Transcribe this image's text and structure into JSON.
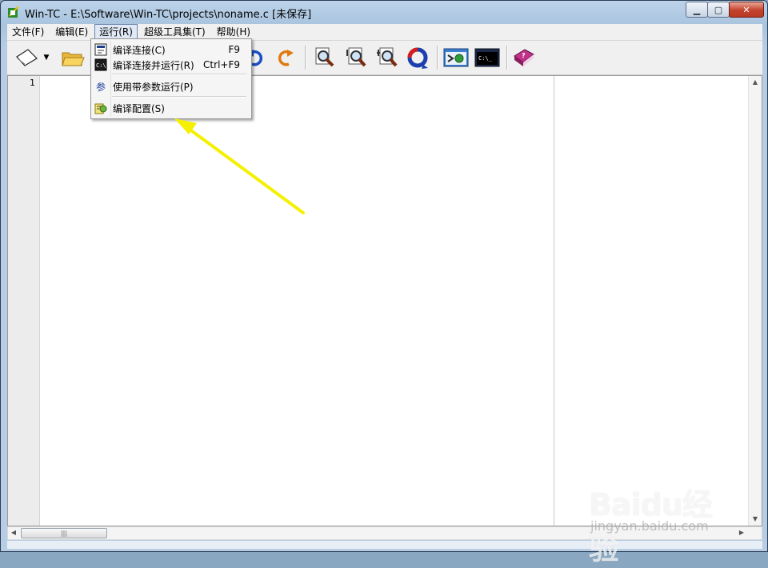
{
  "window": {
    "title": "Win-TC - E:\\Software\\Win-TC\\projects\\noname.c [未保存]",
    "caption_buttons": [
      "minimize",
      "maximize",
      "close"
    ]
  },
  "menubar": {
    "items": [
      {
        "label": "文件(F)",
        "open": false
      },
      {
        "label": "编辑(E)",
        "open": false
      },
      {
        "label": "运行(R)",
        "open": true
      },
      {
        "label": "超级工具集(T)",
        "open": false
      },
      {
        "label": "帮助(H)",
        "open": false
      }
    ]
  },
  "toolbar": {
    "buttons": [
      "new-file-icon",
      "open-folder-icon",
      "undo-icon",
      "redo-icon",
      "find-icon",
      "find-next-icon",
      "replace-icon",
      "refresh-icon",
      "compile-settings-icon",
      "console-icon",
      "help-book-icon"
    ]
  },
  "run_menu": {
    "items": [
      {
        "label": "编译连接(C)",
        "shortcut": "F9",
        "icon": "compile-link-icon"
      },
      {
        "label": "编译连接并运行(R)",
        "shortcut": "Ctrl+F9",
        "icon": "compile-run-icon"
      },
      {
        "label": "使用带参数运行(P)",
        "shortcut": "",
        "icon": "run-params-icon"
      },
      {
        "label": "编译配置(S)",
        "shortcut": "",
        "icon": "compile-config-icon"
      }
    ],
    "icon_glyph_params": "参"
  },
  "editor": {
    "line_numbers": [
      "1"
    ],
    "content": ""
  },
  "scrollbar": {
    "h_thumb_grip": "|||"
  },
  "watermark": {
    "logo": "Baidu经验",
    "url": "jingyan.baidu.com"
  },
  "colors": {
    "annotation_arrow": "#f5f000",
    "menu_highlight": "#dfe8f4"
  }
}
